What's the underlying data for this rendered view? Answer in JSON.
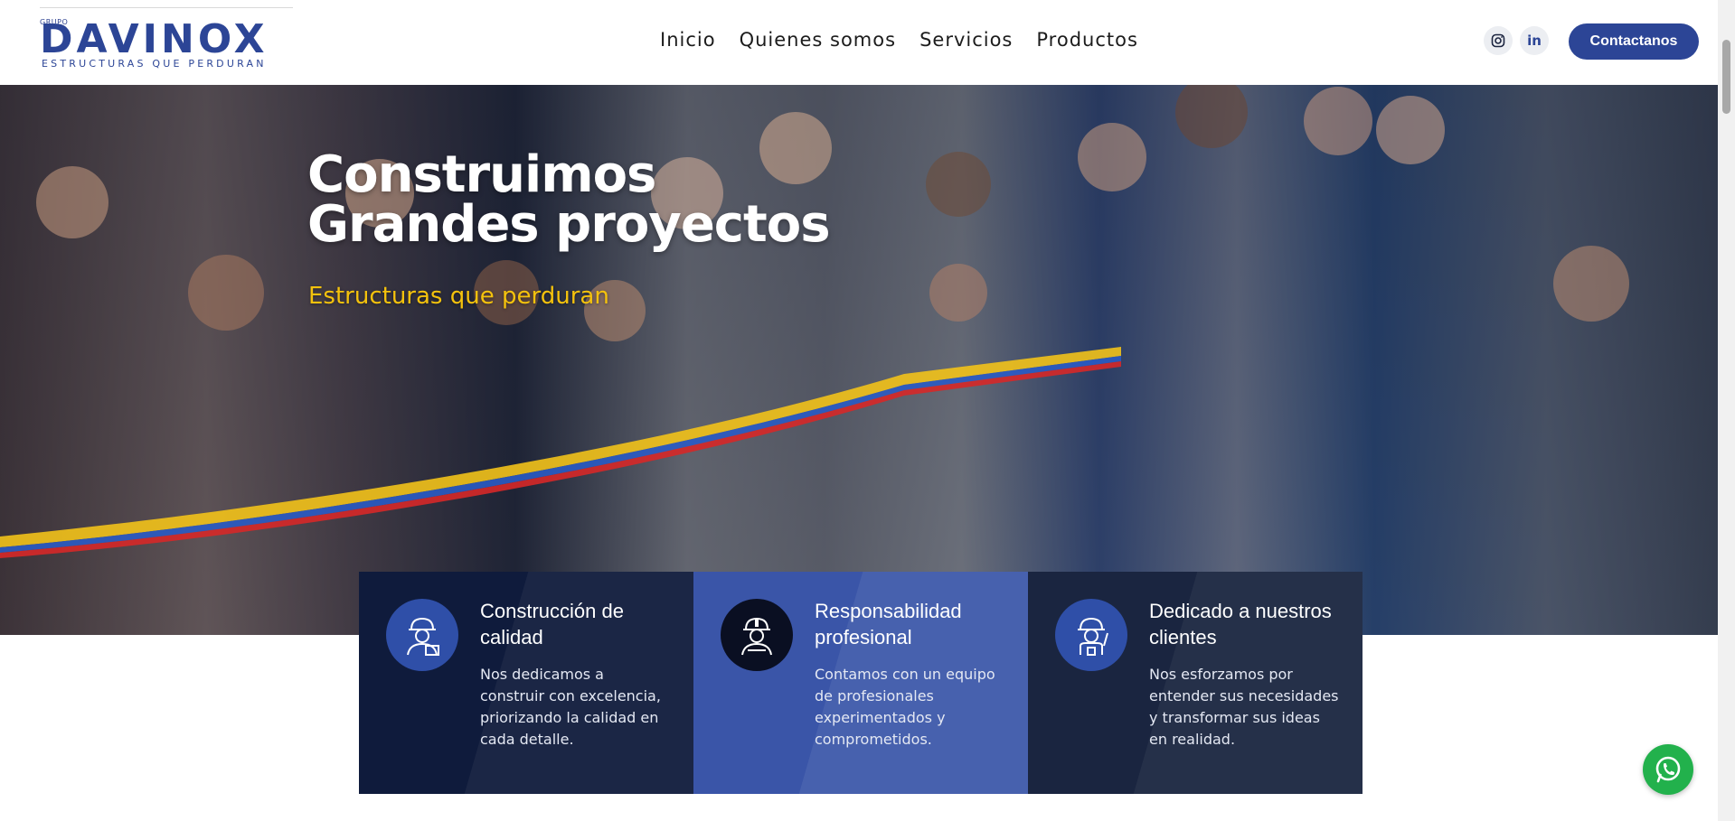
{
  "header": {
    "logo": {
      "prefix": "GRUPO",
      "brand": "DAVINOX",
      "tagline": "ESTRUCTURAS QUE PERDURAN"
    },
    "nav": [
      "Inicio",
      "Quienes somos",
      "Servicios",
      "Productos"
    ],
    "social": [
      "instagram-icon",
      "linkedin-icon"
    ],
    "linkedin_glyph": "in",
    "contact_label": "Contactanos"
  },
  "hero": {
    "title_line1": "Construimos",
    "title_line2": "Grandes proyectos",
    "subtitle": "Estructuras que perduran"
  },
  "features": [
    {
      "title": "Construcción de calidad",
      "text": "Nos dedicamos a construir con excelencia, priorizando la calidad en cada detalle.",
      "icon": "worker-tools-icon"
    },
    {
      "title": "Responsabilidad profesional",
      "text": "Contamos con un equipo de profesionales experimentados y comprometidos.",
      "icon": "worker-helmet-icon"
    },
    {
      "title": "Dedicado a nuestros clientes",
      "text": "Nos esforzamos por entender sus necesidades y transformar sus ideas en realidad.",
      "icon": "worker-wave-icon"
    }
  ],
  "floating": {
    "whatsapp": "whatsapp-icon"
  },
  "colors": {
    "brand_blue": "#2c4596",
    "accent_yellow": "#f4c20d",
    "card_dark": "#0f1b3c",
    "card_blue": "#3a55a8",
    "whatsapp_green": "#22b14c"
  }
}
